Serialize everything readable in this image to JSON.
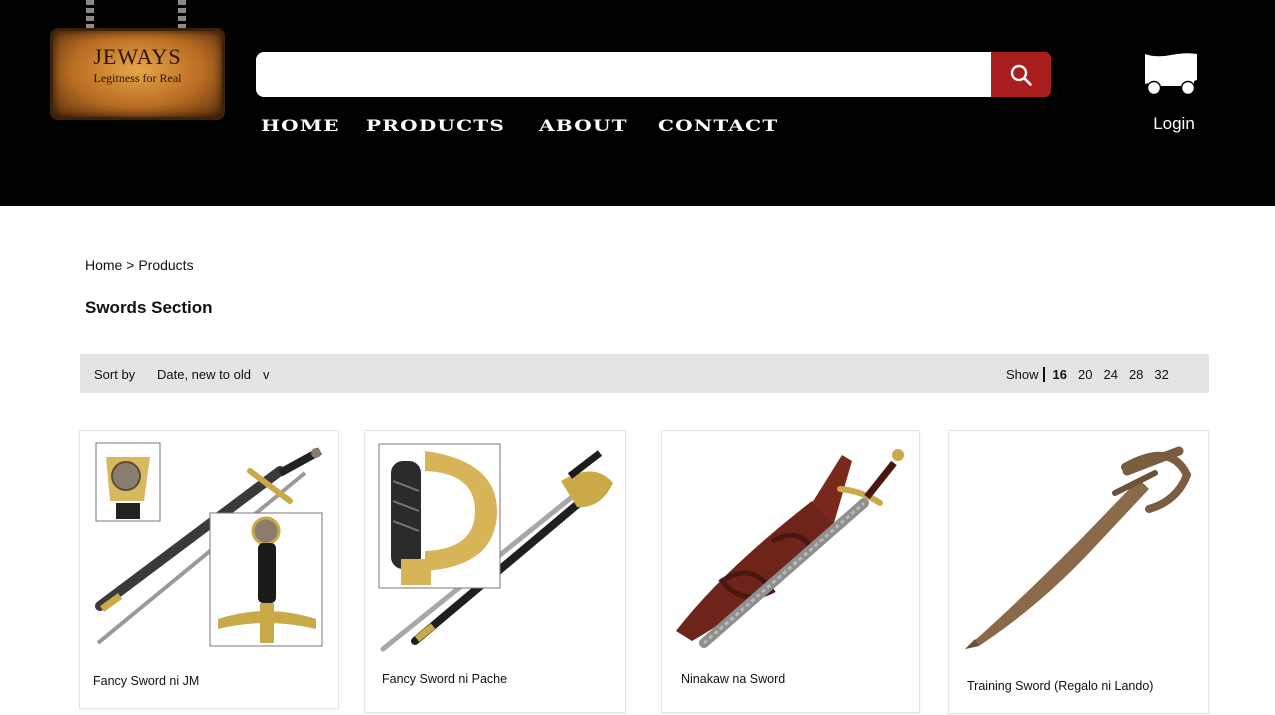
{
  "brand": {
    "title": "JEWAYS",
    "tagline": "Legitness for Real"
  },
  "search": {
    "placeholder": "",
    "value": ""
  },
  "nav": {
    "items": [
      "HOME",
      "PRODUCTS",
      "ABOUT",
      "CONTACT"
    ]
  },
  "account": {
    "login_label": "Login"
  },
  "breadcrumb": {
    "home": "Home",
    "separator": ">",
    "current": "Products"
  },
  "page": {
    "title": "Swords Section"
  },
  "toolbar": {
    "sort_label": "Sort by",
    "sort_value": "Date, new to old",
    "sort_caret": "v",
    "show_label": "Show",
    "show_options": [
      "16",
      "20",
      "24",
      "28",
      "32"
    ],
    "show_selected": "16"
  },
  "products": [
    {
      "name": "Fancy Sword ni JM"
    },
    {
      "name": "Fancy Sword ni Pache"
    },
    {
      "name": "Ninakaw na Sword"
    },
    {
      "name": "Training Sword (Regalo ni Lando)"
    }
  ],
  "colors": {
    "header_bg": "#000000",
    "search_button": "#a81e1e",
    "toolbar_bg": "#e4e4e4"
  }
}
